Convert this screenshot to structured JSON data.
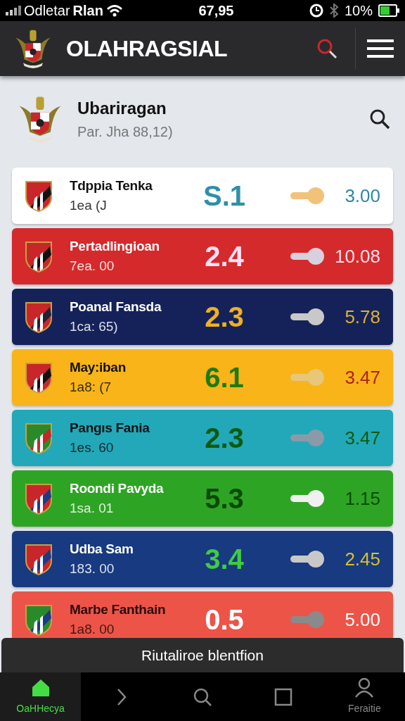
{
  "status_bar": {
    "carrier": "Odletar",
    "network": "Rlan",
    "time": "67,95",
    "battery": "10%"
  },
  "app_bar": {
    "title": "OLAHRAGSIAL"
  },
  "header": {
    "title": "Ubariragan",
    "subtitle": "Par. Jha 88,12)"
  },
  "matches": [
    {
      "name": "Tdppia Tenka",
      "sub": "1ea (J",
      "score": "S.1",
      "odds": "3.00",
      "color": "#ffffff"
    },
    {
      "name": "Pertadlingioan",
      "sub": "7ea. 00",
      "score": "2.4",
      "odds": "10.08",
      "color": "#d42a2c"
    },
    {
      "name": "Poanal Fansda",
      "sub": "1ca: 65)",
      "score": "2.3",
      "odds": "5.78",
      "color": "#15225a"
    },
    {
      "name": "May:iban",
      "sub": "1a8: (7",
      "score": "6.1",
      "odds": "3.47",
      "color": "#f8b418"
    },
    {
      "name": "Pangıs Fania",
      "sub": "1es. 60",
      "score": "2.3",
      "odds": "3.47",
      "color": "#22a8b8"
    },
    {
      "name": "Roondi Pavyda",
      "sub": "1sa. 01",
      "score": "5.3",
      "odds": "1.15",
      "color": "#2ea424"
    },
    {
      "name": "Udba Sam",
      "sub": "183. 00",
      "score": "3.4",
      "odds": "2.45",
      "color": "#173a80"
    },
    {
      "name": "Marbe Fanthain",
      "sub": "1a8. 00",
      "score": "0.5",
      "odds": "5.00",
      "color": "#ec5448"
    }
  ],
  "toast": "Riutaliroe blentfion",
  "bottom_nav": [
    {
      "kind": "home",
      "label": "OaHHecya",
      "selected": true
    },
    {
      "kind": "next",
      "selected": false
    },
    {
      "kind": "search",
      "selected": false
    },
    {
      "kind": "square",
      "selected": false
    },
    {
      "kind": "person",
      "label": "Feraitie",
      "selected": false
    }
  ]
}
